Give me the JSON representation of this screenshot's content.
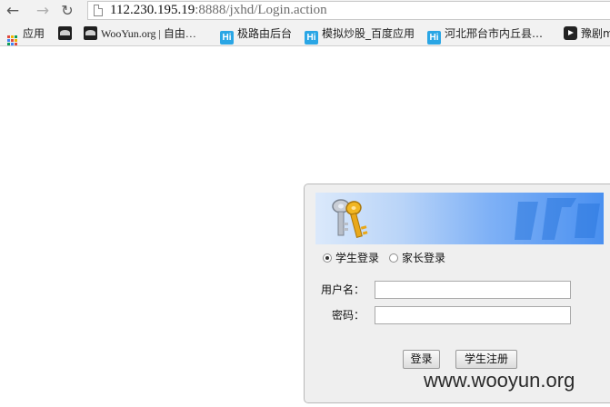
{
  "browser": {
    "back_icon": "arrow-left-icon",
    "forward_icon": "arrow-right-icon",
    "reload_icon": "reload-icon",
    "url_host": "112.230.195.19",
    "url_rest": ":8888/jxhd/Login.action"
  },
  "bookmarks": [
    {
      "label": "应用",
      "icon": "apps-grid-icon"
    },
    {
      "label": "",
      "icon": "dark-bird-icon"
    },
    {
      "label": "WooYun.org | 自由…",
      "icon": "wooyun-icon"
    },
    {
      "label": "极路由后台",
      "icon": "hi-icon"
    },
    {
      "label": "模拟炒股_百度应用",
      "icon": "hi-icon"
    },
    {
      "label": "河北邢台市内丘县…",
      "icon": "hi-icon"
    },
    {
      "label": "豫剧m",
      "icon": "play-icon"
    }
  ],
  "login": {
    "roles": [
      "学生登录",
      "家长登录"
    ],
    "selected_role": "学生登录",
    "username_label": "用户名：",
    "username_value": "",
    "password_label": "密码：",
    "password_value": "",
    "login_button": "登录",
    "register_button": "学生注册"
  },
  "watermark": "www.wooyun.org",
  "colors": {
    "banner_start": "#dbe9fb",
    "banner_end": "#4a90f0",
    "hi_blue": "#2aa6e5"
  }
}
